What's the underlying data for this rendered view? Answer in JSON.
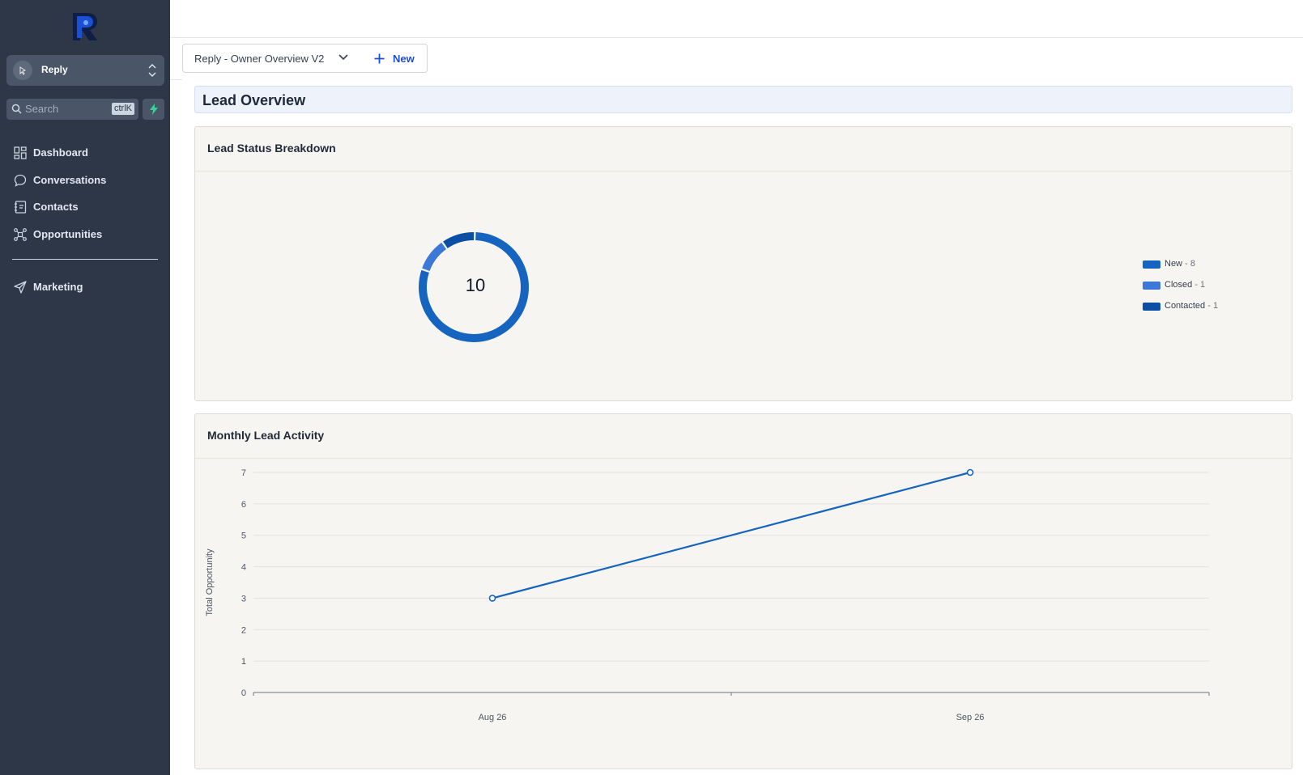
{
  "sidebar": {
    "account_name": "Reply",
    "search_placeholder": "Search",
    "search_shortcut": "ctrlK",
    "nav": [
      {
        "label": "Dashboard",
        "icon": "dashboard-icon"
      },
      {
        "label": "Conversations",
        "icon": "chat-bubble-icon"
      },
      {
        "label": "Contacts",
        "icon": "contacts-book-icon"
      },
      {
        "label": "Opportunities",
        "icon": "opportunities-icon"
      },
      {
        "label": "Marketing",
        "icon": "paper-plane-icon"
      }
    ]
  },
  "toolbar": {
    "dashboard_name": "Reply - Owner Overview V2",
    "new_label": "New"
  },
  "section": {
    "title": "Lead Overview"
  },
  "status_card": {
    "title": "Lead Status Breakdown",
    "total": "10",
    "legend": [
      {
        "label": "New",
        "value": "8",
        "color": "#1565c0"
      },
      {
        "label": "Closed",
        "value": "1",
        "color": "#3b78d8"
      },
      {
        "label": "Contacted",
        "value": "1",
        "color": "#0a4fa3"
      }
    ]
  },
  "activity_card": {
    "title": "Monthly Lead Activity"
  },
  "chart_data": [
    {
      "type": "pie",
      "title": "Lead Status Breakdown",
      "center_label": "10",
      "categories": [
        "New",
        "Closed",
        "Contacted"
      ],
      "values": [
        8,
        1,
        1
      ],
      "colors": [
        "#1565c0",
        "#3b78d8",
        "#0a4fa3"
      ],
      "legend": "right"
    },
    {
      "type": "line",
      "title": "Monthly Lead Activity",
      "x": [
        "Aug 26",
        "Sep 26"
      ],
      "series": [
        {
          "values": [
            3,
            7
          ],
          "color": "#1565c0"
        }
      ],
      "ylabel": "Total Opportunity",
      "yticks": [
        0,
        1,
        2,
        3,
        4,
        5,
        6,
        7
      ],
      "ylim": [
        0,
        7
      ],
      "grid": true
    }
  ],
  "colors": {
    "sidebar": "#2d3748",
    "accent": "#1565c0"
  }
}
